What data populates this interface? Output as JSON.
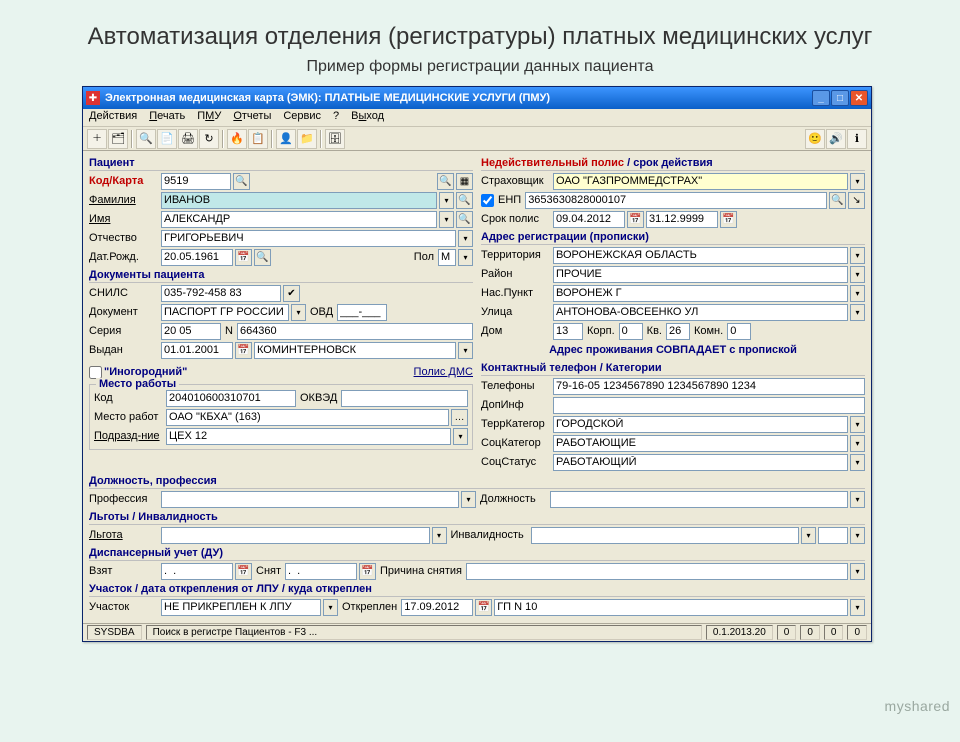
{
  "slide": {
    "title": "Автоматизация отделения (регистратуры) платных медицинских услуг",
    "subtitle": "Пример формы регистрации данных пациента"
  },
  "window_title": "Электронная медицинская карта (ЭМК): ПЛАТНЫЕ МЕДИЦИНСКИЕ УСЛУГИ (ПМУ)",
  "menu": {
    "actions": "Действия",
    "print": "Печать",
    "pmu": "ПМУ",
    "reports": "Отчеты",
    "service": "Сервис",
    "help": "?",
    "exit": "Выход"
  },
  "patient": {
    "section": "Пациент",
    "kod_karta_lbl": "Код/Карта",
    "kod_value": "9519",
    "familia_lbl": "Фамилия",
    "familia_value": "ИВАНОВ",
    "imya_lbl": "Имя",
    "imya_value": "АЛЕКСАНДР",
    "otchestvo_lbl": "Отчество",
    "otchestvo_value": "ГРИГОРЬЕВИЧ",
    "dob_lbl": "Дат.Рожд.",
    "dob_value": "20.05.1961",
    "pol_lbl": "Пол",
    "pol_value": "М"
  },
  "docs": {
    "section": "Документы пациента",
    "snils_lbl": "СНИЛС",
    "snils_value": "035-792-458 83",
    "doc_lbl": "Документ",
    "doc_value": "ПАСПОРТ ГР РОССИИ",
    "ovd_lbl": "ОВД",
    "ovd_mask": "___-___",
    "seria_lbl": "Серия",
    "seria_value": "20 05",
    "n_lbl": "N",
    "n_value": "664360",
    "vidan_lbl": "Выдан",
    "vidan_date": "01.01.2001",
    "vidan_by": "КОМИНТЕРНОВСК"
  },
  "inogor": {
    "chk_lbl": "\"Иногородний\"",
    "polis_dms": "Полис ДМС",
    "mesto_section": "Место работы",
    "kod_lbl": "Код",
    "kod_value": "204010600310701",
    "okved_lbl": "ОКВЭД",
    "mesto_lbl": "Место работ",
    "mesto_value": "ОАО \"КБХА\" (163)",
    "podr_lbl": "Подразд-ние",
    "podr_value": "ЦЕХ 12"
  },
  "prof": {
    "section": "Должность, профессия",
    "prof_lbl": "Профессия",
    "dolzh_lbl": "Должность"
  },
  "lgoty": {
    "section": "Льготы / Инвалидность",
    "lgota_lbl": "Льгота",
    "inval_lbl": "Инвалидность"
  },
  "disp": {
    "section": "Диспансерный учет (ДУ)",
    "vzyat_lbl": "Взят",
    "snyat_lbl": "Снят",
    "prich_lbl": "Причина снятия",
    "date_mask": ".  ."
  },
  "uchastok": {
    "section": "Участок / дата открепления от ЛПУ / куда откреплен",
    "uch_lbl": "Участок",
    "uch_value": "НЕ ПРИКРЕПЛЕН К ЛПУ",
    "otkr_lbl": "Откреплен",
    "otkr_date": "17.09.2012",
    "gp_value": "ГП N 10"
  },
  "policy": {
    "section_invalid": "Недействительный полис",
    "section_sep": " / ",
    "section_srok": "срок действия",
    "strah_lbl": "Страховщик",
    "strah_value": "ОАО \"ГАЗПРОММЕДСТРАХ\"",
    "enp_lbl": "ЕНП",
    "enp_value": "3653630828000107",
    "srok_lbl": "Срок полис",
    "srok_from": "09.04.2012",
    "srok_to": "31.12.9999"
  },
  "addr": {
    "section": "Адрес регистрации (прописки)",
    "terr_lbl": "Территория",
    "terr_value": "ВОРОНЕЖСКАЯ ОБЛАСТЬ",
    "raion_lbl": "Район",
    "raion_value": "ПРОЧИЕ",
    "nas_lbl": "Нас.Пункт",
    "nas_value": "ВОРОНЕЖ Г",
    "ulica_lbl": "Улица",
    "ulica_value": "АНТОНОВА-ОВСЕЕНКО УЛ",
    "dom_lbl": "Дом",
    "dom_value": "13",
    "korp_lbl": "Корп.",
    "korp_value": "0",
    "kv_lbl": "Кв.",
    "kv_value": "26",
    "komn_lbl": "Комн.",
    "komn_value": "0",
    "match": "Адрес проживания СОВПАДАЕТ с пропиской"
  },
  "contact": {
    "section": "Контактный телефон / Категории",
    "tel_lbl": "Телефоны",
    "tel_value": "79-16-05 1234567890 1234567890 1234",
    "dop_lbl": "ДопИнф",
    "terrkat_lbl": "ТеррКатегор",
    "terrkat_value": "ГОРОДСКОЙ",
    "sockat_lbl": "СоцКатегор",
    "sockat_value": "РАБОТАЮЩИЕ",
    "socst_lbl": "СоцСтатус",
    "socst_value": "РАБОТАЮЩИЙ"
  },
  "status": {
    "user": "SYSDBA",
    "hint": "Поиск в регистре Пациентов - F3 ...",
    "ver": "0.1.2013.20",
    "z1": "0",
    "z2": "0",
    "z3": "0",
    "z4": "0"
  },
  "watermark": "myshared"
}
